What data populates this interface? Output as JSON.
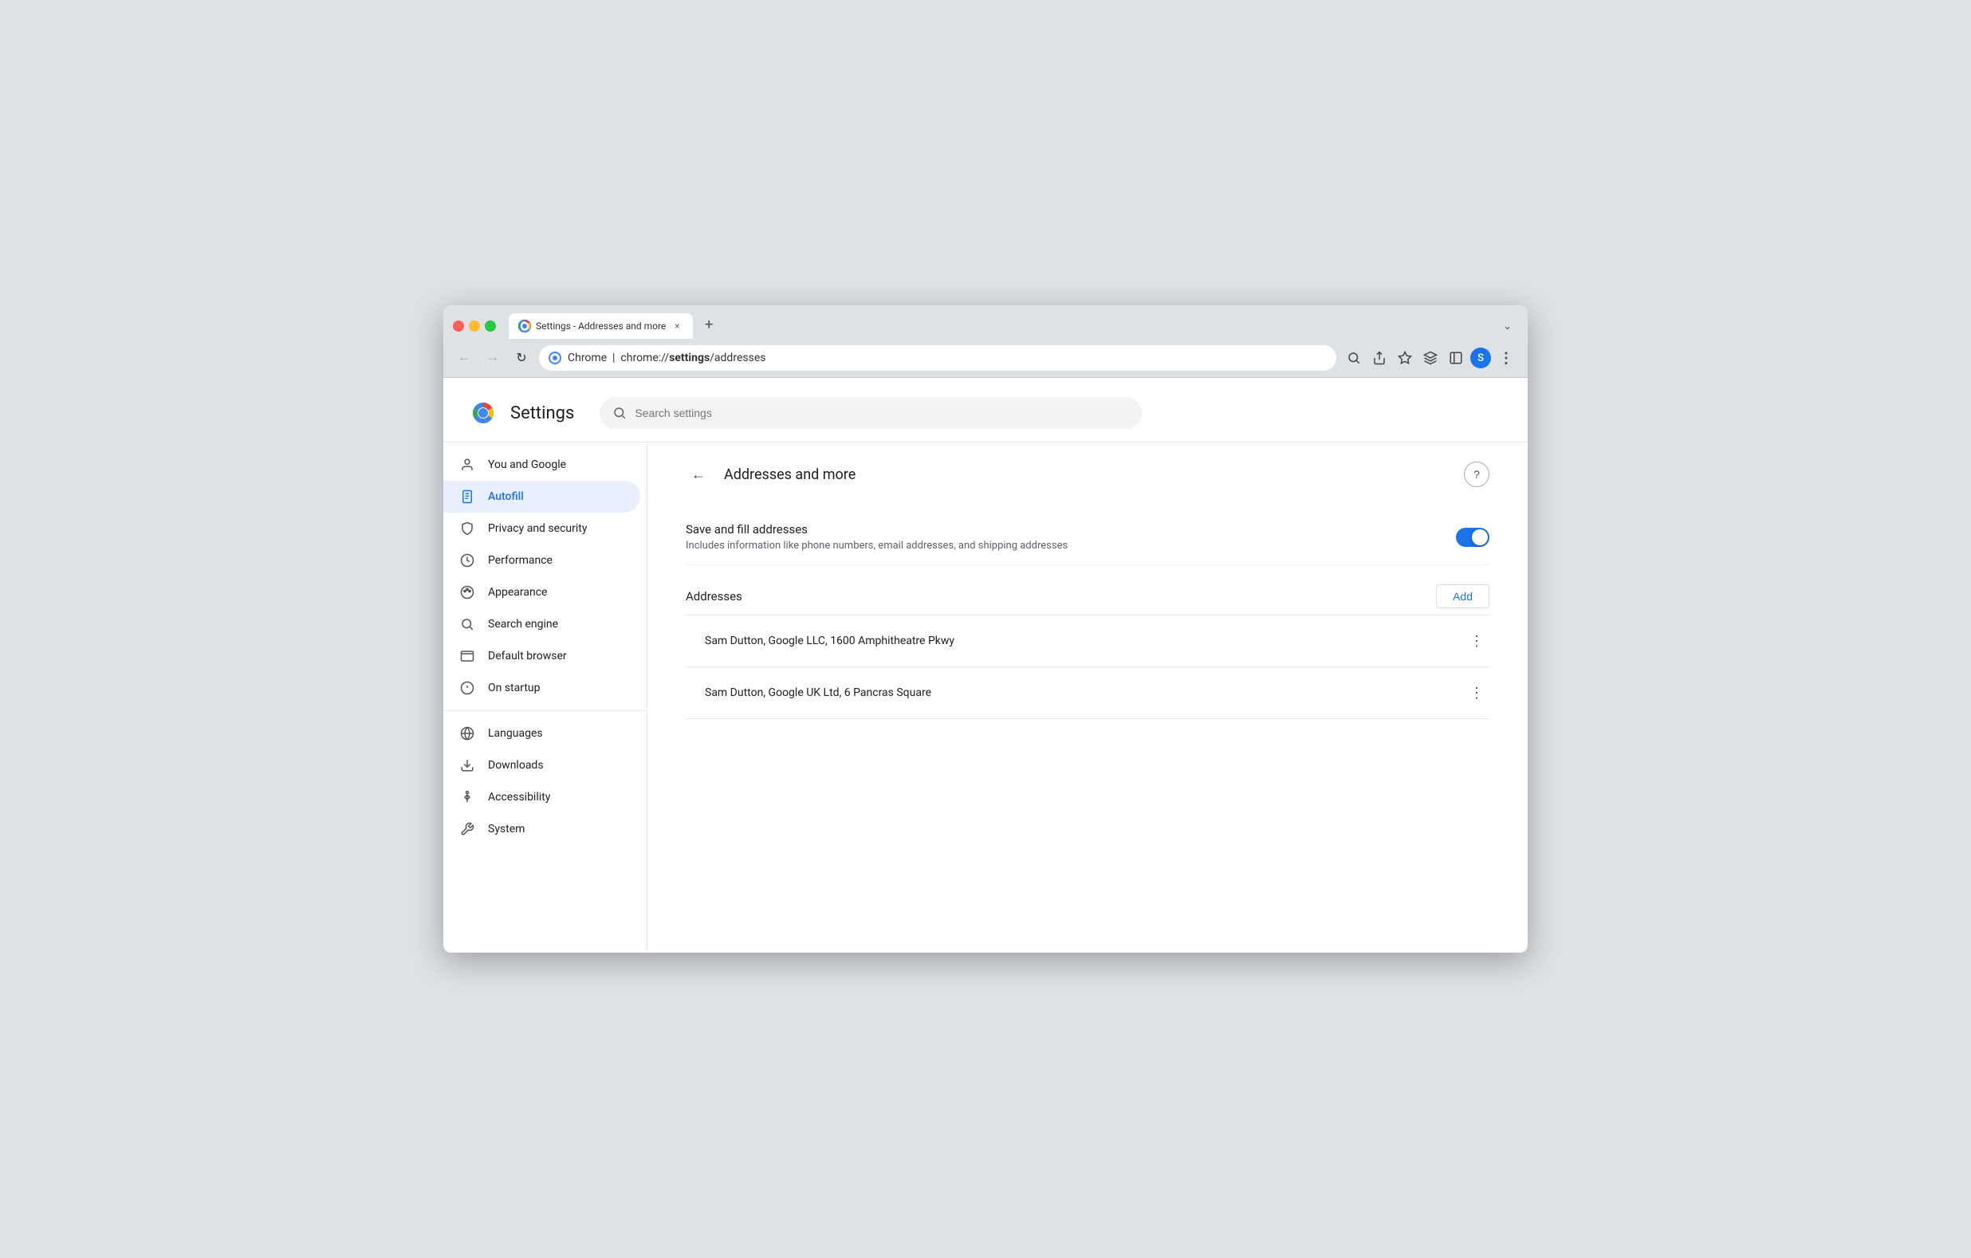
{
  "browser": {
    "tab_title": "Settings - Addresses and more",
    "tab_close": "×",
    "new_tab": "+",
    "url_prefix": "Chrome  |  chrome://",
    "url_bold": "settings",
    "url_suffix": "/addresses",
    "url_full": "chrome://settings/addresses",
    "chevron_down": "⌄"
  },
  "toolbar": {
    "back_icon": "←",
    "forward_icon": "→",
    "reload_icon": "↻",
    "search_icon": "🔍",
    "share_icon": "⬆",
    "bookmark_icon": "☆",
    "extensions_icon": "🧩",
    "sidebar_icon": "▣",
    "profile_initial": "S",
    "menu_icon": "⋮"
  },
  "settings": {
    "title": "Settings",
    "search_placeholder": "Search settings"
  },
  "sidebar": {
    "items": [
      {
        "id": "you-and-google",
        "label": "You and Google",
        "icon": "👤",
        "active": false
      },
      {
        "id": "autofill",
        "label": "Autofill",
        "icon": "📋",
        "active": true
      },
      {
        "id": "privacy-security",
        "label": "Privacy and security",
        "icon": "🛡",
        "active": false
      },
      {
        "id": "performance",
        "label": "Performance",
        "icon": "⏱",
        "active": false
      },
      {
        "id": "appearance",
        "label": "Appearance",
        "icon": "🎨",
        "active": false
      },
      {
        "id": "search-engine",
        "label": "Search engine",
        "icon": "🔍",
        "active": false
      },
      {
        "id": "default-browser",
        "label": "Default browser",
        "icon": "🖥",
        "active": false
      },
      {
        "id": "on-startup",
        "label": "On startup",
        "icon": "⏻",
        "active": false
      }
    ],
    "items2": [
      {
        "id": "languages",
        "label": "Languages",
        "icon": "🌐",
        "active": false
      },
      {
        "id": "downloads",
        "label": "Downloads",
        "icon": "⬇",
        "active": false
      },
      {
        "id": "accessibility",
        "label": "Accessibility",
        "icon": "♿",
        "active": false
      },
      {
        "id": "system",
        "label": "System",
        "icon": "🔧",
        "active": false
      }
    ]
  },
  "page": {
    "back_icon": "←",
    "title": "Addresses and more",
    "help_icon": "?",
    "save_fill_label": "Save and fill addresses",
    "save_fill_desc": "Includes information like phone numbers, email addresses, and shipping addresses",
    "toggle_on": true,
    "addresses_label": "Addresses",
    "add_button": "Add",
    "addresses": [
      {
        "id": 1,
        "text": "Sam Dutton, Google LLC, 1600 Amphitheatre Pkwy"
      },
      {
        "id": 2,
        "text": "Sam Dutton, Google UK Ltd, 6 Pancras Square"
      }
    ],
    "more_icon": "⋮"
  }
}
